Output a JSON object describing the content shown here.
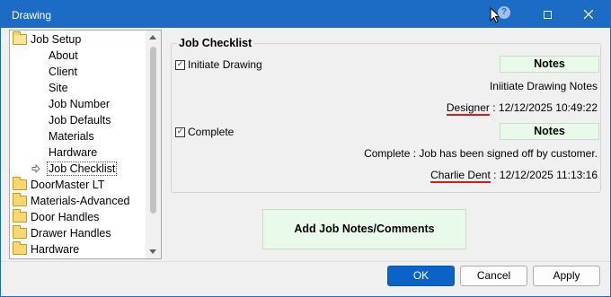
{
  "window": {
    "title": "Drawing"
  },
  "titlebar": {
    "help": "?",
    "maximize": "☐",
    "close": "✕"
  },
  "tree": {
    "items": [
      {
        "label": "Job Setup",
        "level": 0,
        "folder": "open"
      },
      {
        "label": "About",
        "level": 1
      },
      {
        "label": "Client",
        "level": 1
      },
      {
        "label": "Site",
        "level": 1
      },
      {
        "label": "Job Number",
        "level": 1
      },
      {
        "label": "Job Defaults",
        "level": 1
      },
      {
        "label": "Materials",
        "level": 1
      },
      {
        "label": "Hardware",
        "level": 1
      },
      {
        "label": "Job Checklist",
        "level": 1,
        "selected": true
      },
      {
        "label": "DoorMaster LT",
        "level": 0,
        "folder": "closed"
      },
      {
        "label": "Materials-Advanced",
        "level": 0,
        "folder": "closed"
      },
      {
        "label": "Door Handles",
        "level": 0,
        "folder": "closed"
      },
      {
        "label": "Drawer Handles",
        "level": 0,
        "folder": "closed"
      },
      {
        "label": "Hardware",
        "level": 0,
        "folder": "closed"
      }
    ]
  },
  "checklist": {
    "title": "Job Checklist",
    "items": [
      {
        "label": "Initiate Drawing",
        "checked": true,
        "notes_label": "Notes",
        "note_text": "Iniitiate Drawing Notes",
        "signer": "Designer",
        "timestamp": " : 12/12/2025 10:49:22"
      },
      {
        "label": "Complete",
        "checked": true,
        "notes_label": "Notes",
        "note_text": "Complete : Job has been signed off by customer.",
        "signer": "Charlie Dent",
        "timestamp": " : 12/12/2025 11:13:16"
      }
    ]
  },
  "add_notes_label": "Add Job Notes/Comments",
  "buttons": {
    "ok": "OK",
    "cancel": "Cancel",
    "apply": "Apply"
  },
  "colors": {
    "titlebar": "#1c6bc4",
    "notes_bg": "#eafaea",
    "primary": "#0a64c8",
    "underline": "#d81c1c"
  }
}
